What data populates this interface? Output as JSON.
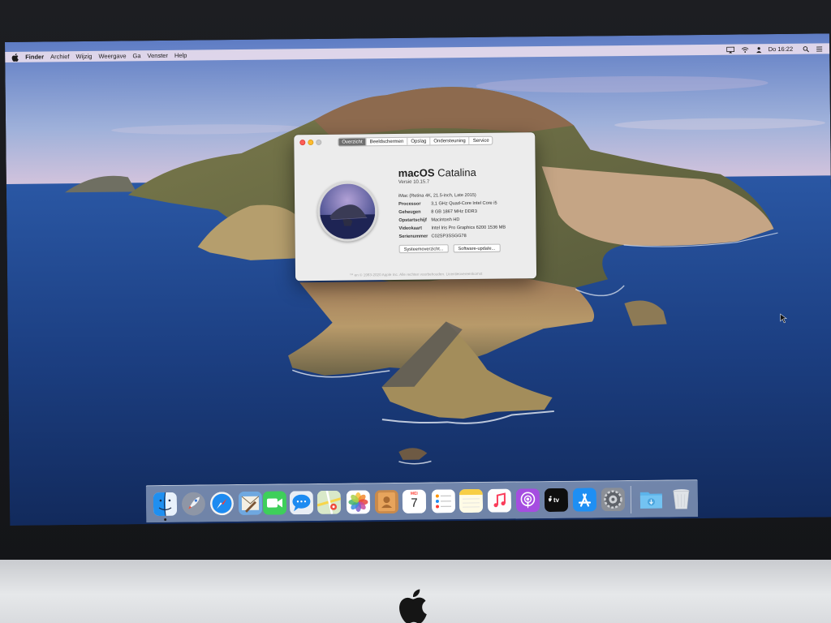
{
  "menubar": {
    "items": [
      "Finder",
      "Archief",
      "Wijzig",
      "Weergave",
      "Ga",
      "Venster",
      "Help"
    ],
    "clock": "Do 16:22"
  },
  "about_window": {
    "tabs": [
      "Overzicht",
      "Beeldschermen",
      "Opslag",
      "Ondersteuning",
      "Service"
    ],
    "active_tab": "Overzicht",
    "os_name_bold": "macOS",
    "os_name_rest": "Catalina",
    "version": "Versie 10.15.7",
    "model": "iMac (Retina 4K, 21.5-inch, Late 2015)",
    "specs": [
      {
        "key": "Processor",
        "value": "3,1 GHz Quad-Core Intel Core i5"
      },
      {
        "key": "Geheugen",
        "value": "8 GB 1867 MHz DDR3"
      },
      {
        "key": "Opstartschijf",
        "value": "Macintosh HD"
      },
      {
        "key": "Videokaart",
        "value": "Intel Iris Pro Graphics 6200 1536 MB"
      },
      {
        "key": "Serienummer",
        "value": "C02SP3SSGG78"
      }
    ],
    "buttons": {
      "system_report": "Systeemoverzicht...",
      "software_update": "Software-update..."
    },
    "footer": "™ en © 1983-2020 Apple Inc. Alle rechten voorbehouden. Licentieovereenkomst"
  },
  "dock": {
    "apps": [
      "Finder",
      "Launchpad",
      "Safari",
      "Mail",
      "FaceTime",
      "Berichten",
      "Kaarten",
      "Foto's",
      "Contacten",
      "Agenda",
      "Herinneringen",
      "Notities",
      "Muziek",
      "Podcasts",
      "TV",
      "App Store",
      "Systeemvoorkeuren",
      "Downloads",
      "Prullenmand"
    ],
    "calendar_month": "MEI",
    "calendar_day": "7"
  },
  "colors": {
    "sky_top": "#6d88c8",
    "sea": "#1f3d7c",
    "menubar": "#eee0ee",
    "window_bg": "#ececec",
    "active_tab": "#6f6f6f"
  }
}
